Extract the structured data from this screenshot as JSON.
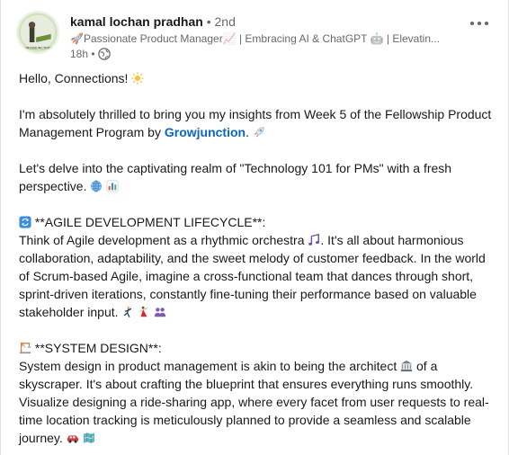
{
  "post": {
    "author": {
      "name": "kamal lochan pradhan",
      "degree": "• 2nd",
      "headline": "🚀Passionate Product Manager📈 | Embracing AI & ChatGPT 🤖 | Elevatin...",
      "time": "18h •"
    },
    "body": {
      "greeting": "Hello, Connections!",
      "p1_text": "I'm absolutely thrilled to bring you my insights from Week 5 of the Fellowship Product Management Program by ",
      "p1_link": "Growjunction",
      "p1_after": ".",
      "p2": "Let's delve into the captivating realm of \"Technology 101 for PMs\" with a fresh perspective.",
      "agile_title": "**AGILE DEVELOPMENT LIFECYCLE**:",
      "agile_text_1": "Think of Agile development as a rhythmic orchestra",
      "agile_text_2": ". It's all about harmonious collaboration, adaptability, and the sweet melody of customer feedback. In the world of Scrum-based Agile, imagine a cross-functional team that dances through short, sprint-driven iterations, constantly fine-tuning their performance based on valuable stakeholder input.",
      "system_title": "**SYSTEM DESIGN**:",
      "system_text_1": "System design in product management is akin to being the architect",
      "system_text_2": "of a skyscraper. It's about crafting the blueprint that ensures everything runs smoothly. Visualize designing a ride-sharing app, where every facet from user requests to real-time location tracking is meticulously planned to provide a seamless and scalable journey."
    }
  },
  "colors": {
    "link": "#0a66c2",
    "text": "#191919",
    "muted": "#666666"
  },
  "icons": [
    "avatar",
    "globe-icon",
    "more-options-icon",
    "sun-icon",
    "rocket-icon",
    "globe-emoji-icon",
    "bar-chart-icon",
    "cycle-icon",
    "music-notes-icon",
    "dancer-man-icon",
    "dancer-woman-icon",
    "people-icon",
    "building-construction-icon",
    "classical-building-icon",
    "car-icon",
    "map-icon"
  ]
}
